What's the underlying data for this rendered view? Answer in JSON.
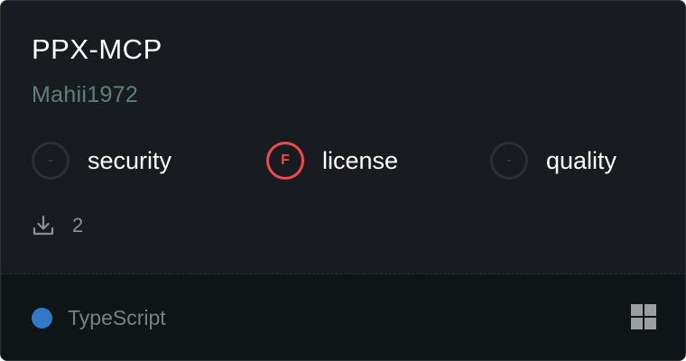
{
  "card": {
    "title": "PPX-MCP",
    "author": "Mahii1972",
    "scores": [
      {
        "name": "security",
        "grade": "-",
        "status": "none"
      },
      {
        "name": "license",
        "grade": "F",
        "status": "fail"
      },
      {
        "name": "quality",
        "grade": "-",
        "status": "none"
      }
    ],
    "downloads": {
      "icon": "download-icon",
      "count": "2"
    },
    "language": {
      "name": "TypeScript",
      "color": "#3178c6"
    },
    "badge_icon": "grid-icon"
  }
}
